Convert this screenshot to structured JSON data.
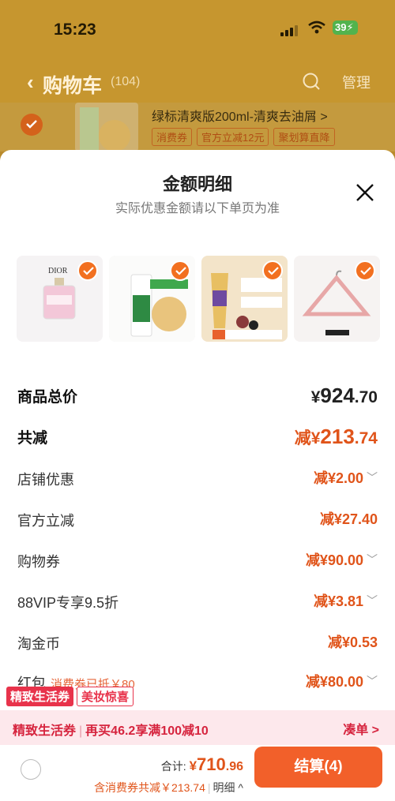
{
  "status_bar": {
    "time": "15:23",
    "battery": "39"
  },
  "nav": {
    "title": "购物车",
    "count": "(104)",
    "manage": "管理"
  },
  "background_item": {
    "name": "绿标清爽版200ml-清爽去油屑 >",
    "tags": [
      "消费券",
      "官方立减12元",
      "聚划算直降"
    ]
  },
  "sheet": {
    "title": "金额明细",
    "subtitle": "实际优惠金额请以下单页为准",
    "products": [
      {
        "name": "dior-perfume"
      },
      {
        "name": "shampoo-green-label"
      },
      {
        "name": "pantene-conditioner"
      },
      {
        "name": "hanger"
      }
    ],
    "rows": [
      {
        "label": "商品总价",
        "currency": "¥",
        "integer": "924",
        "decimal": ".70",
        "prefix": ""
      },
      {
        "label": "共减",
        "currency": "¥",
        "integer": "213",
        "decimal": ".74",
        "prefix": "减"
      },
      {
        "label": "店铺优惠",
        "value": "减¥2.00"
      },
      {
        "label": "官方立减",
        "value": "减¥27.40"
      },
      {
        "label": "购物券",
        "value": "减¥90.00"
      },
      {
        "label": "88VIP专享9.5折",
        "value": "减¥3.81"
      },
      {
        "label": "淘金币",
        "value": "减¥0.53"
      },
      {
        "label": "红包",
        "note": "消费券已抵￥80",
        "value": "减¥80.00"
      }
    ]
  },
  "tags": {
    "t1": "精致生活券",
    "t2": "美妆惊喜"
  },
  "promo": {
    "label": "精致生活券",
    "text": "再买46.2享满100减10",
    "action": "凑单 >"
  },
  "footer": {
    "total_label": "合计: ",
    "currency": "¥",
    "amount": "710",
    "decimal": ".96",
    "saved": "含消费券共减￥213.74",
    "detail": "明细 ^",
    "pay_button": "结算(4)"
  },
  "colors": {
    "accent": "#f2602a",
    "price": "#e0541a",
    "promo": "#d6243e"
  }
}
